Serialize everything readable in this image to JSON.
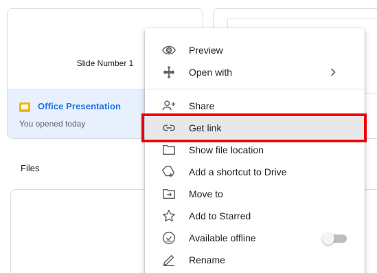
{
  "recent": {
    "office_card": {
      "thumbnail_text": "Slide Number 1",
      "file_name": "Office Presentation",
      "meta": "You opened today"
    }
  },
  "sections": {
    "files_label": "Files"
  },
  "context_menu": {
    "items": [
      {
        "label": "Preview",
        "icon": "eye-icon"
      },
      {
        "label": "Open with",
        "icon": "move-icon",
        "has_submenu": true
      },
      {
        "label": "Share",
        "icon": "person-add-icon"
      },
      {
        "label": "Get link",
        "icon": "link-icon",
        "highlighted": true
      },
      {
        "label": "Show file location",
        "icon": "folder-icon"
      },
      {
        "label": "Add a shortcut to Drive",
        "icon": "drive-shortcut-icon"
      },
      {
        "label": "Move to",
        "icon": "move-to-folder-icon"
      },
      {
        "label": "Add to Starred",
        "icon": "star-icon"
      },
      {
        "label": "Available offline",
        "icon": "offline-check-icon",
        "toggle": false
      },
      {
        "label": "Rename",
        "icon": "pencil-icon"
      }
    ]
  },
  "colors": {
    "accent": "#1a73e8",
    "highlight_border": "#ee0000",
    "slides_yellow": "#f4b400"
  }
}
